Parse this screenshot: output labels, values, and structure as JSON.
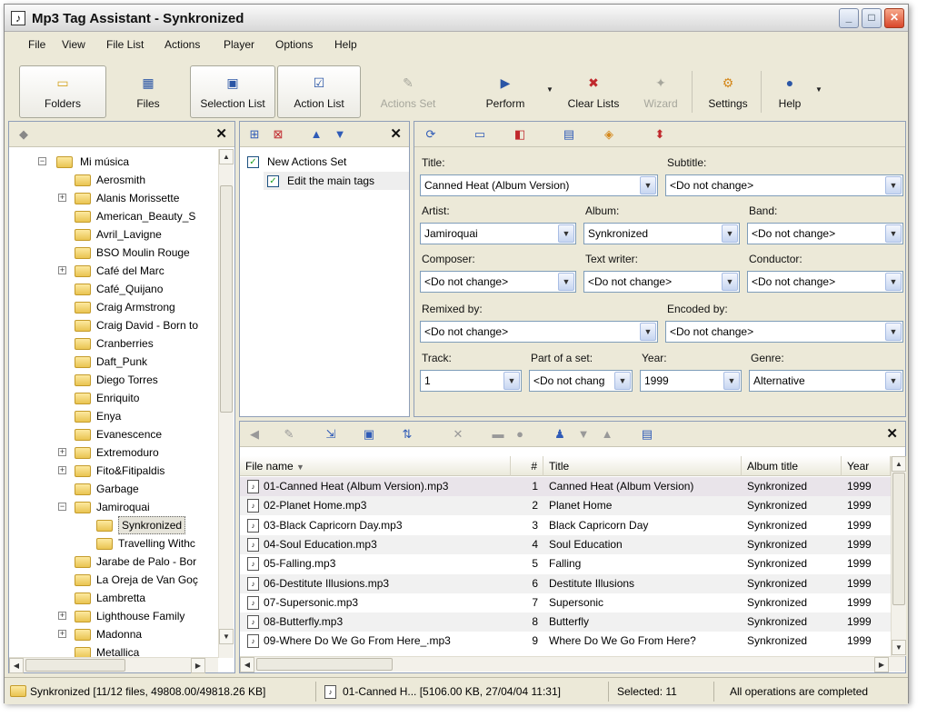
{
  "window": {
    "title": "Mp3 Tag Assistant - Synkronized"
  },
  "menu": [
    "File",
    "View",
    "File List",
    "Actions",
    "Player",
    "Options",
    "Help"
  ],
  "toolbar": {
    "folders": "Folders",
    "files": "Files",
    "selection_list": "Selection List",
    "action_list": "Action List",
    "action_set": "Actions Set",
    "perform": "Perform",
    "clear_lists": "Clear Lists",
    "wizard": "Wizard",
    "settings": "Settings",
    "help": "Help"
  },
  "tree": {
    "root": "Mi música",
    "items": [
      "Aerosmith",
      "Alanis Morissette",
      "American_Beauty_S",
      "Avril_Lavigne",
      "BSO Moulin Rouge",
      "Café del Marc",
      "Café_Quijano",
      "Craig Armstrong",
      "Craig David - Born to",
      "Cranberries",
      "Daft_Punk",
      "Diego Torres",
      "Enriquito",
      "Enya",
      "Evanescence",
      "Extremoduro",
      "Fito&Fitipaldis",
      "Garbage",
      "Jamiroquai",
      "Synkronized",
      "Travelling Withc",
      "Jarabe de Palo - Bor",
      "La Oreja de Van Goç",
      "Lambretta",
      "Lighthouse Family",
      "Madonna",
      "Metallica"
    ]
  },
  "actions": {
    "set_name": "New Actions Set",
    "action": "Edit the main tags"
  },
  "tags": {
    "title_label": "Title:",
    "title_value": "Canned Heat (Album Version)",
    "subtitle_label": "Subtitle:",
    "subtitle_value": "<Do not change>",
    "artist_label": "Artist:",
    "artist_value": "Jamiroquai",
    "album_label": "Album:",
    "album_value": "Synkronized",
    "band_label": "Band:",
    "band_value": "<Do not change>",
    "composer_label": "Composer:",
    "composer_value": "<Do not change>",
    "textwriter_label": "Text writer:",
    "textwriter_value": "<Do not change>",
    "conductor_label": "Conductor:",
    "conductor_value": "<Do not change>",
    "remixed_label": "Remixed by:",
    "remixed_value": "<Do not change>",
    "encoded_label": "Encoded by:",
    "encoded_value": "<Do not change>",
    "track_label": "Track:",
    "track_value": "1",
    "partset_label": "Part of a set:",
    "partset_value": "<Do not chang",
    "year_label": "Year:",
    "year_value": "1999",
    "genre_label": "Genre:",
    "genre_value": "Alternative"
  },
  "filelist": {
    "columns": [
      "File name",
      "#",
      "Title",
      "Album title",
      "Year"
    ],
    "rows": [
      [
        "01-Canned Heat (Album Version).mp3",
        "1",
        "Canned Heat (Album Version)",
        "Synkronized",
        "1999"
      ],
      [
        "02-Planet Home.mp3",
        "2",
        "Planet Home",
        "Synkronized",
        "1999"
      ],
      [
        "03-Black Capricorn Day.mp3",
        "3",
        "Black Capricorn Day",
        "Synkronized",
        "1999"
      ],
      [
        "04-Soul Education.mp3",
        "4",
        "Soul Education",
        "Synkronized",
        "1999"
      ],
      [
        "05-Falling.mp3",
        "5",
        "Falling",
        "Synkronized",
        "1999"
      ],
      [
        "06-Destitute Illusions.mp3",
        "6",
        "Destitute Illusions",
        "Synkronized",
        "1999"
      ],
      [
        "07-Supersonic.mp3",
        "7",
        "Supersonic",
        "Synkronized",
        "1999"
      ],
      [
        "08-Butterfly.mp3",
        "8",
        "Butterfly",
        "Synkronized",
        "1999"
      ],
      [
        "09-Where Do We Go From Here_.mp3",
        "9",
        "Where Do We Go From Here?",
        "Synkronized",
        "1999"
      ]
    ]
  },
  "status": {
    "folder": "Synkronized [11/12 files, 49808.00/49818.26 KB]",
    "file": "01-Canned H... [5106.00 KB, 27/04/04 11:31]",
    "selected": "Selected: 11",
    "operations": "All operations are completed"
  }
}
